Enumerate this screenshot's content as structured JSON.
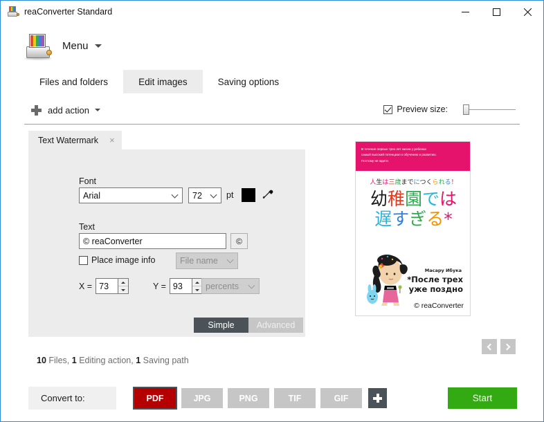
{
  "window": {
    "title": "reaConverter Standard",
    "icon": "printer-icon",
    "minimize": "—",
    "maximize": "□",
    "close": "✕"
  },
  "menu": {
    "label": "Menu"
  },
  "tabs": [
    {
      "label": "Files and folders",
      "active": false
    },
    {
      "label": "Edit images",
      "active": true
    },
    {
      "label": "Saving options",
      "active": false
    }
  ],
  "toolbar": {
    "add_action_label": "add action",
    "preview_size_label": "Preview size:",
    "preview_size_checked": true,
    "preview_slider_value": 0
  },
  "action_panel": {
    "tab_label": "Text Watermark",
    "tab_close": "×",
    "font_label": "Font",
    "font_value": "Arial",
    "font_size_value": "72",
    "pt_label": "pt",
    "color_value": "#000000",
    "eyedropper_icon": "eyedropper-icon",
    "text_label": "Text",
    "text_value": "© reaConverter",
    "copyright_button": "©",
    "place_image_info_label": "Place image info",
    "place_image_info_checked": false,
    "image_info_value": "File name",
    "x_label": "X =",
    "x_value": "73",
    "y_label": "Y =",
    "y_value": "93",
    "units_value": "percents",
    "mode_simple": "Simple",
    "mode_advanced": "Advanced",
    "mode_active": "Simple"
  },
  "preview": {
    "banner_line1": "В течение первых трех лет жизни у ребенка",
    "banner_line2": "самый высокий потенциал к обучению и развитию.",
    "banner_line3": "Поэтому не ждите.",
    "jp_subtitle": "人生は三歳までにつくられる！",
    "jp_title_line1": "幼稚園では",
    "jp_title_line2": "遅すぎる*",
    "author": "Масару Ибука",
    "title_ru_line1": "*После трех",
    "title_ru_line2": "уже поздно",
    "watermark": "© reaConverter",
    "banner_color": "#e5136c"
  },
  "status": {
    "files_count": "10",
    "files_label": "Files,",
    "actions_count": "1",
    "actions_label": "Editing action,",
    "paths_count": "1",
    "paths_label": "Saving path"
  },
  "bottom": {
    "convert_to_label": "Convert to:",
    "formats": [
      {
        "label": "PDF",
        "selected": true
      },
      {
        "label": "JPG",
        "selected": false
      },
      {
        "label": "PNG",
        "selected": false
      },
      {
        "label": "TIF",
        "selected": false
      },
      {
        "label": "GIF",
        "selected": false
      }
    ],
    "add_format_icon": "plus-icon",
    "start_label": "Start",
    "start_color": "#33aa11",
    "selected_format_color": "#b40000"
  }
}
